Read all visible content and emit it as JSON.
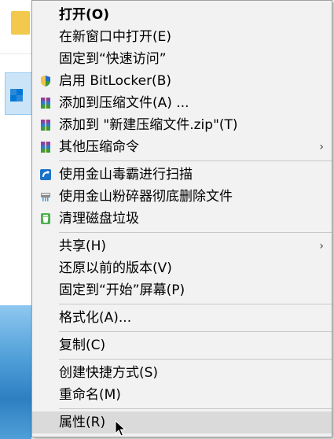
{
  "menu": {
    "items": [
      {
        "label": "打开(O)"
      },
      {
        "label": "在新窗口中打开(E)"
      },
      {
        "label": "固定到“快速访问”"
      },
      {
        "label": "启用 BitLocker(B)"
      },
      {
        "label": "添加到压缩文件(A) ..."
      },
      {
        "label": "添加到 \"新建压缩文件.zip\"(T)"
      },
      {
        "label": "其他压缩命令"
      },
      {
        "label": "使用金山毒霸进行扫描"
      },
      {
        "label": "使用金山粉碎器彻底删除文件"
      },
      {
        "label": "清理磁盘垃圾"
      },
      {
        "label": "共享(H)"
      },
      {
        "label": "还原以前的版本(V)"
      },
      {
        "label": "固定到“开始”屏幕(P)"
      },
      {
        "label": "格式化(A)..."
      },
      {
        "label": "复制(C)"
      },
      {
        "label": "创建快捷方式(S)"
      },
      {
        "label": "重命名(M)"
      },
      {
        "label": "属性(R)"
      }
    ],
    "submenu_arrow": "›"
  },
  "icons": {
    "bitlocker": "shield-icon",
    "archive": "winrar-icon",
    "duba_scan": "duba-scan-icon",
    "shredder": "shredder-icon",
    "cleanup": "trash-cleanup-icon"
  },
  "colors": {
    "menu_bg": "#f2f2f2",
    "highlight": "#dadada",
    "separator": "#c8c8c8"
  }
}
